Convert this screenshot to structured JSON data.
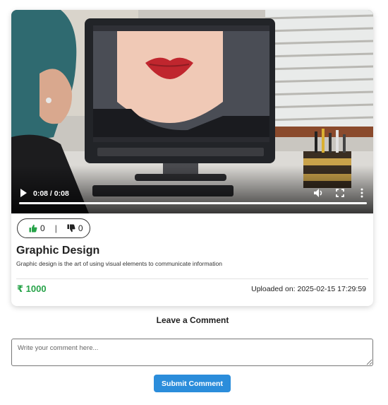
{
  "video": {
    "time_display": "0:08 / 0:08",
    "progress_fraction": 1.0
  },
  "votes": {
    "likes": "0",
    "separator": "|",
    "dislikes": "0",
    "like_icon": "thumbs-up-icon",
    "dislike_icon": "thumbs-down-icon"
  },
  "course": {
    "title": "Graphic Design",
    "description": "Graphic design is the art of using visual elements to communicate information",
    "price": "₹ 1000",
    "uploaded": "Uploaded on: 2025-02-15 17:29:59"
  },
  "comments": {
    "heading": "Leave a Comment",
    "placeholder": "Write your comment here...",
    "submit_label": "Submit Comment"
  },
  "colors": {
    "price": "#27a349",
    "like_icon": "#27a349",
    "submit_button": "#2b8ddb"
  }
}
